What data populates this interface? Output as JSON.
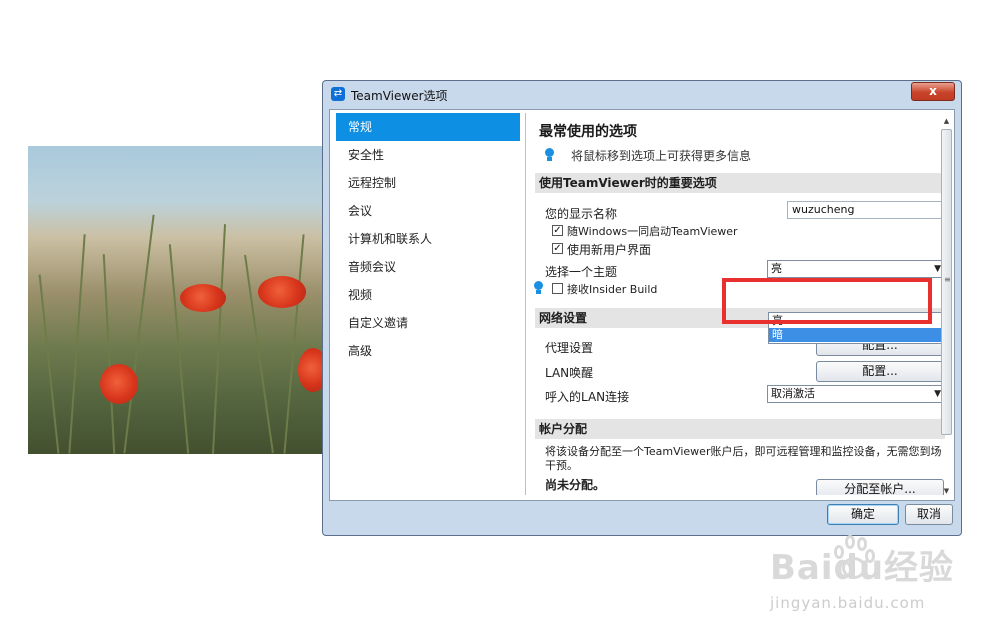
{
  "window": {
    "title": "TeamViewer选项",
    "close_glyph": "x",
    "logo_icon": "teamviewer-logo-icon"
  },
  "nav": {
    "items": [
      {
        "label": "常规",
        "active": true
      },
      {
        "label": "安全性"
      },
      {
        "label": "远程控制"
      },
      {
        "label": "会议"
      },
      {
        "label": "计算机和联系人"
      },
      {
        "label": "音频会议"
      },
      {
        "label": "视频"
      },
      {
        "label": "自定义邀请"
      },
      {
        "label": "高级"
      }
    ]
  },
  "content": {
    "heading": "最常使用的选项",
    "hint": "将鼠标移到选项上可获得更多信息",
    "section_important": "使用TeamViewer时的重要选项",
    "display_name_label": "您的显示名称",
    "display_name_value": "wuzucheng",
    "startup_with_windows": {
      "label": "随Windows一同启动TeamViewer",
      "checked": true
    },
    "new_ui": {
      "label": "使用新用户界面",
      "checked": true
    },
    "theme_label": "选择一个主题",
    "theme_value": "亮",
    "theme_options": [
      "亮",
      "暗"
    ],
    "theme_highlighted_option": "暗",
    "insider_build": {
      "label": "接收Insider Build",
      "checked": false
    },
    "section_network": "网络设置",
    "proxy_label": "代理设置",
    "proxy_button": "配置...",
    "lan_wake_label": "LAN唤醒",
    "lan_wake_button": "配置...",
    "incoming_lan_label": "呼入的LAN连接",
    "incoming_lan_value": "取消激活",
    "section_account": "帐户分配",
    "account_desc": "将该设备分配至一个TeamViewer账户后，即可远程管理和监控设备，无需您到场干预。",
    "unassigned": "尚未分配。",
    "assign_button": "分配至帐户..."
  },
  "footer": {
    "ok_button": "确定",
    "cancel_button": "取消"
  },
  "annotation": {
    "color": "#e8302f"
  },
  "watermark": {
    "brand": "Baidu经验",
    "url": "jingyan.baidu.com"
  },
  "colors": {
    "accent": "#0d8fe4",
    "window_frame": "#c9d9ec"
  }
}
